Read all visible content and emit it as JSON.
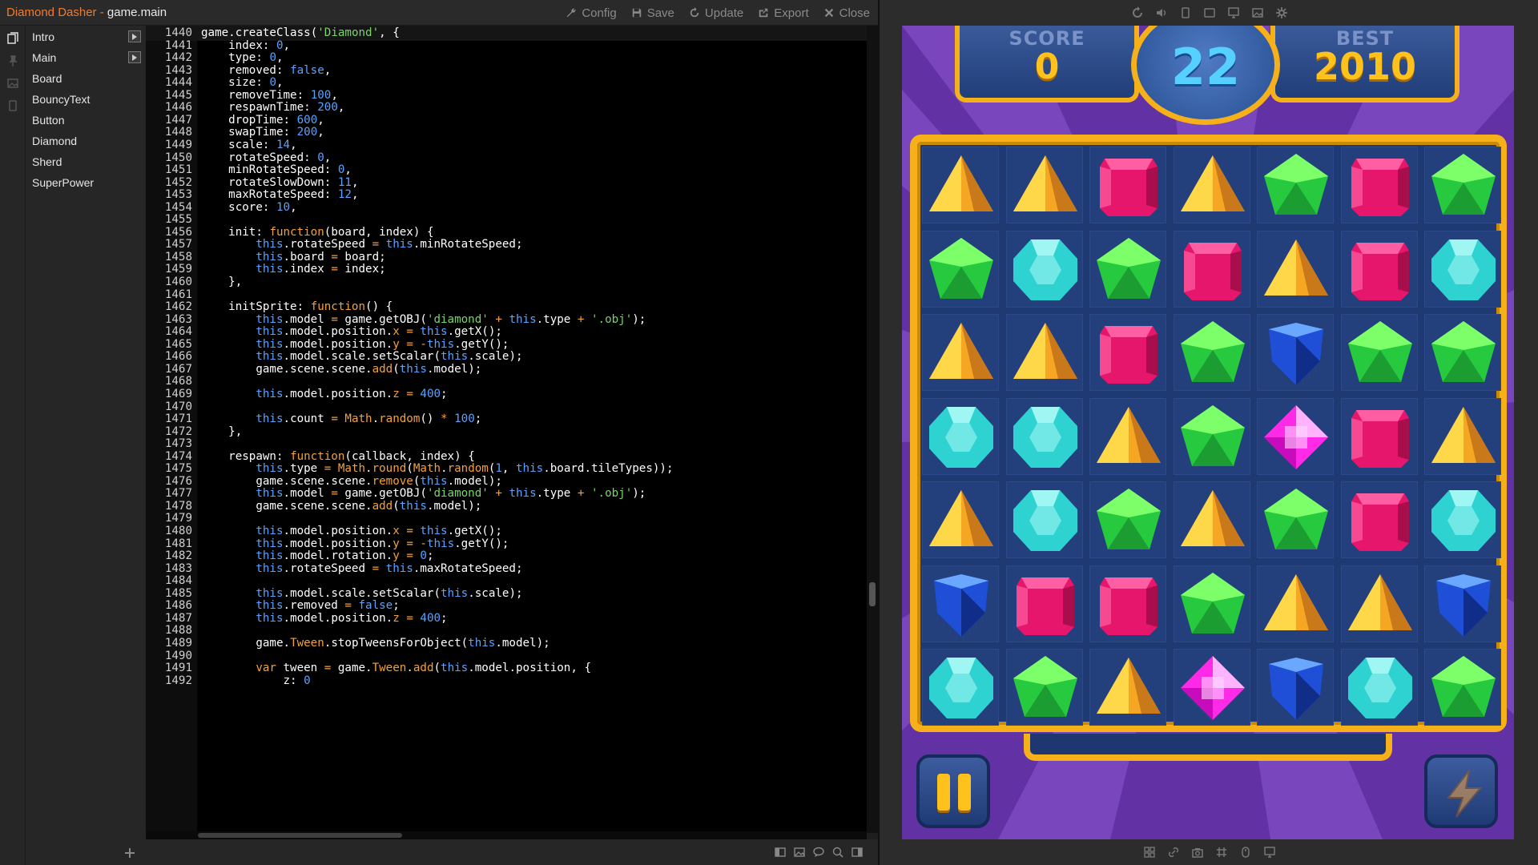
{
  "window": {
    "app_name": "Diamond Dasher",
    "separator": " - ",
    "file_name": "game.main"
  },
  "toolbar": {
    "config": "Config",
    "save": "Save",
    "update": "Update",
    "export": "Export",
    "close": "Close"
  },
  "sidebar": {
    "items": [
      {
        "label": "Intro",
        "playable": true
      },
      {
        "label": "Main",
        "playable": true
      },
      {
        "label": "Board",
        "playable": false
      },
      {
        "label": "BouncyText",
        "playable": false
      },
      {
        "label": "Button",
        "playable": false
      },
      {
        "label": "Diamond",
        "playable": false
      },
      {
        "label": "Sherd",
        "playable": false
      },
      {
        "label": "SuperPower",
        "playable": false
      }
    ]
  },
  "code": {
    "first_line": 1440,
    "current_line": 1440,
    "lines": [
      "game.createClass('Diamond', {",
      "    index: 0,",
      "    type: 0,",
      "    removed: false,",
      "    size: 0,",
      "    removeTime: 100,",
      "    respawnTime: 200,",
      "    dropTime: 600,",
      "    swapTime: 200,",
      "    scale: 14,",
      "    rotateSpeed: 0,",
      "    minRotateSpeed: 0,",
      "    rotateSlowDown: 11,",
      "    maxRotateSpeed: 12,",
      "    score: 10,",
      "",
      "    init: function(board, index) {",
      "        this.rotateSpeed = this.minRotateSpeed;",
      "        this.board = board;",
      "        this.index = index;",
      "    },",
      "",
      "    initSprite: function() {",
      "        this.model = game.getOBJ('diamond' + this.type + '.obj');",
      "        this.model.position.x = this.getX();",
      "        this.model.position.y = -this.getY();",
      "        this.model.scale.setScalar(this.scale);",
      "        game.scene.scene.add(this.model);",
      "",
      "        this.model.position.z = 400;",
      "",
      "        this.count = Math.random() * 100;",
      "    },",
      "",
      "    respawn: function(callback, index) {",
      "        this.type = Math.round(Math.random(1, this.board.tileTypes));",
      "        game.scene.scene.remove(this.model);",
      "        this.model = game.getOBJ('diamond' + this.type + '.obj');",
      "        game.scene.scene.add(this.model);",
      "",
      "        this.model.position.x = this.getX();",
      "        this.model.position.y = -this.getY();",
      "        this.model.rotation.y = 0;",
      "        this.rotateSpeed = this.maxRotateSpeed;",
      "",
      "        this.model.scale.setScalar(this.scale);",
      "        this.removed = false;",
      "        this.model.position.z = 400;",
      "",
      "        game.Tween.stopTweensForObject(this.model);",
      "",
      "        var tween = game.Tween.add(this.model.position, {",
      "            z: 0"
    ]
  },
  "game": {
    "score_label": "SCORE",
    "score_value": "0",
    "timer_value": "22",
    "best_label": "BEST",
    "best_value": "2010",
    "board": [
      [
        "yellow",
        "yellow",
        "pink",
        "yellow",
        "green",
        "pink",
        "green"
      ],
      [
        "green",
        "cyan",
        "green",
        "pink",
        "yellow",
        "pink",
        "cyan"
      ],
      [
        "yellow",
        "yellow",
        "pink",
        "green",
        "blue",
        "green",
        "green"
      ],
      [
        "cyan",
        "cyan",
        "yellow",
        "green",
        "magenta",
        "pink",
        "yellow"
      ],
      [
        "yellow",
        "cyan",
        "green",
        "yellow",
        "green",
        "pink",
        "cyan"
      ],
      [
        "blue",
        "pink",
        "pink",
        "green",
        "yellow",
        "yellow",
        "blue"
      ],
      [
        "cyan",
        "green",
        "yellow",
        "magenta",
        "blue",
        "cyan",
        "green"
      ]
    ]
  },
  "colors": {
    "accent_orange": "#f27b2e",
    "gold_frame": "#f6b11a",
    "purple_bg": "#6a3aa8"
  },
  "icons": {
    "config": "wrench-icon",
    "save": "floppy-disk-icon",
    "update": "refresh-icon",
    "export": "export-icon",
    "close": "close-icon"
  }
}
